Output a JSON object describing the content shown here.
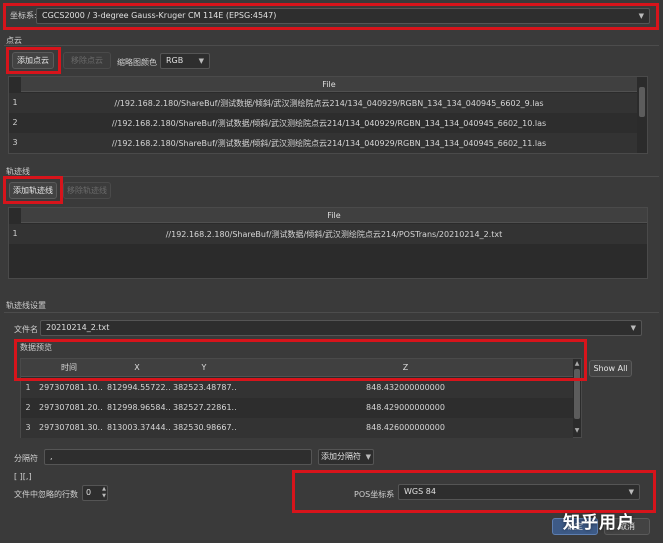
{
  "crs": {
    "label": "坐标系:",
    "value": "CGCS2000 / 3-degree Gauss-Kruger CM 114E (EPSG:4547)"
  },
  "pointcloud": {
    "section_title": "点云",
    "add_button": "添加点云",
    "remove_button": "移除点云",
    "color_label": "缩略图颜色",
    "color_value": "RGB",
    "column_header": "File",
    "rows": [
      {
        "num": "1",
        "file": "//192.168.2.180/ShareBuf/测试数据/倾斜/武汉测绘院点云214/134_040929/RGBN_134_134_040945_6602_9.las"
      },
      {
        "num": "2",
        "file": "//192.168.2.180/ShareBuf/测试数据/倾斜/武汉测绘院点云214/134_040929/RGBN_134_134_040945_6602_10.las"
      },
      {
        "num": "3",
        "file": "//192.168.2.180/ShareBuf/测试数据/倾斜/武汉测绘院点云214/134_040929/RGBN_134_134_040945_6602_11.las"
      }
    ]
  },
  "trajectory": {
    "section_title": "轨迹线",
    "add_button": "添加轨迹线",
    "remove_button": "移除轨迹线",
    "column_header": "File",
    "rows": [
      {
        "num": "1",
        "file": "//192.168.2.180/ShareBuf/测试数据/倾斜/武汉测绘院点云214/POSTrans/20210214_2.txt"
      }
    ]
  },
  "settings": {
    "section_title": "轨迹线设置",
    "filename_label": "文件名",
    "filename_value": "20210214_2.txt",
    "preview_title": "数据预览",
    "columns": [
      "时间",
      "X",
      "Y",
      "Z"
    ],
    "show_all": "Show All",
    "rows": [
      {
        "num": "1",
        "t": "297307081.10...",
        "x": "812994.55722...",
        "y": "382523.48787...",
        "z": "848.432000000000"
      },
      {
        "num": "2",
        "t": "297307081.20...",
        "x": "812998.96584...",
        "y": "382527.22861...",
        "z": "848.429000000000"
      },
      {
        "num": "3",
        "t": "297307081.30...",
        "x": "813003.37444...",
        "y": "382530.98667...",
        "z": "848.426000000000"
      }
    ],
    "separator_label": "分隔符",
    "separator_value": ",",
    "add_separator": "添加分隔符",
    "separator_list": "[ ][,]",
    "ignore_label": "文件中忽略的行数",
    "ignore_value": "0",
    "pos_crs_label": "POS坐标系",
    "pos_crs_value": "WGS 84"
  },
  "footer": {
    "ok": "确定",
    "cancel": "取消"
  },
  "watermark": "知乎用户"
}
